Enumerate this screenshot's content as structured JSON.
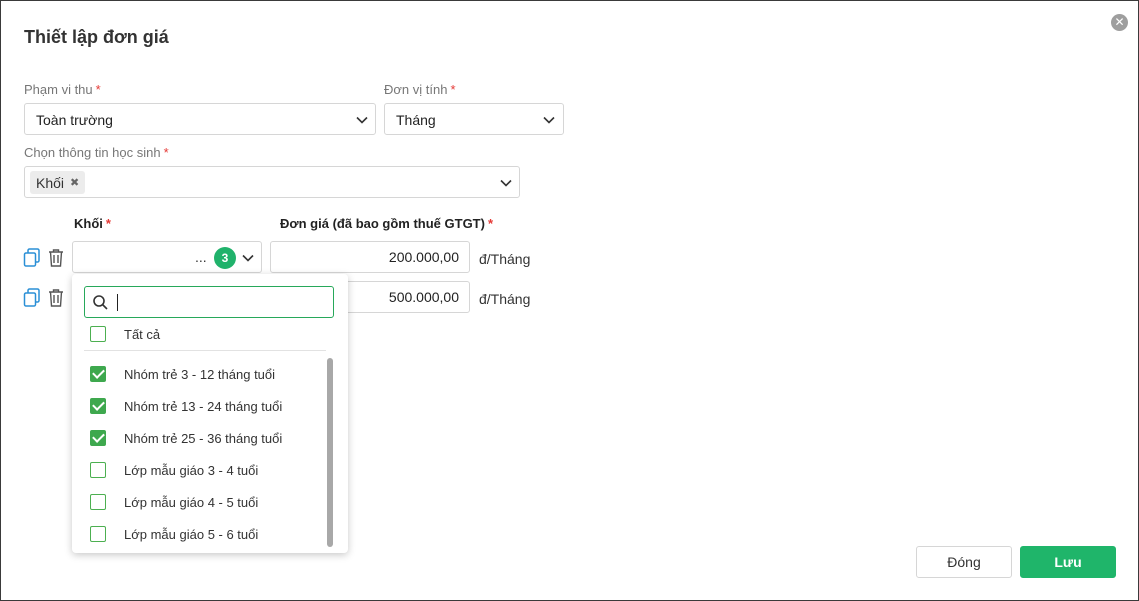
{
  "dialog": {
    "title": "Thiết lập đơn giá",
    "close_icon": "close-circle-icon"
  },
  "form": {
    "scope": {
      "label": "Phạm vi thu",
      "required_mark": "*",
      "value": "Toàn trường"
    },
    "unit": {
      "label": "Đơn vị tính",
      "required_mark": "*",
      "value": "Tháng"
    },
    "student_info": {
      "label": "Chọn thông tin học sinh",
      "required_mark": "*",
      "tags": [
        "Khối"
      ],
      "tag_remove_glyph": "✖"
    }
  },
  "columns": {
    "grade": {
      "label": "Khối",
      "required_mark": "*"
    },
    "price": {
      "label": "Đơn giá (đã bao gồm thuế GTGT)",
      "required_mark": "*"
    }
  },
  "rows": [
    {
      "grade_display": "...",
      "selected_count": "3",
      "price": "200.000,00",
      "unit_suffix": "đ/Tháng"
    },
    {
      "price": "500.000,00",
      "unit_suffix": "đ/Tháng"
    }
  ],
  "dropdown": {
    "search_value": "",
    "select_all": {
      "label": "Tất cả",
      "checked": false
    },
    "options": [
      {
        "label": "Nhóm trẻ 3 - 12 tháng tuổi",
        "checked": true
      },
      {
        "label": "Nhóm trẻ 13 - 24 tháng tuổi",
        "checked": true
      },
      {
        "label": "Nhóm trẻ 25 - 36 tháng tuổi",
        "checked": true
      },
      {
        "label": "Lớp mẫu giáo 3 - 4 tuổi",
        "checked": false
      },
      {
        "label": "Lớp mẫu giáo 4 - 5 tuổi",
        "checked": false
      },
      {
        "label": "Lớp mẫu giáo 5 - 6 tuổi",
        "checked": false
      }
    ]
  },
  "footer": {
    "close_label": "Đóng",
    "save_label": "Lưu"
  },
  "colors": {
    "accent_green": "#1fb56a",
    "checkbox_green": "#3ea84e",
    "required_red": "#e53935",
    "icon_blue": "#2a8fd6"
  }
}
